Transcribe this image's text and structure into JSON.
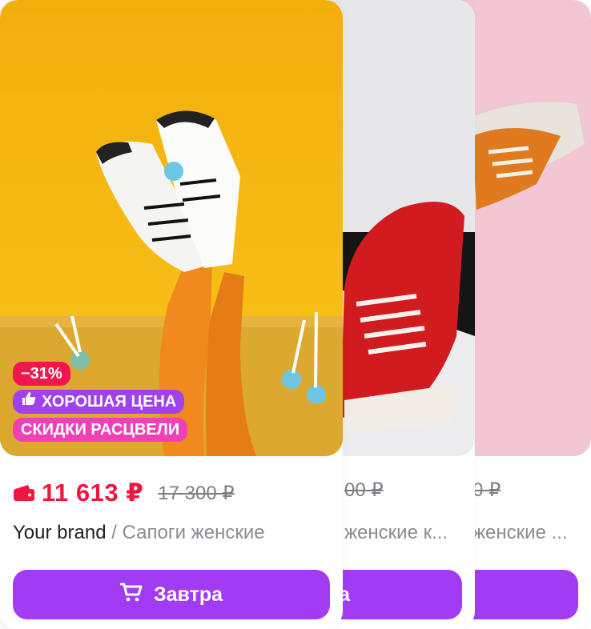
{
  "cards": [
    {
      "discount": "−31%",
      "good_price": "ХОРОШАЯ ЦЕНА",
      "promo": "СКИДКИ РАСЦВЕЛИ",
      "price": "11 613 ₽",
      "old_price": "17 300 ₽",
      "brand": "Your brand",
      "name": " / Сапоги женские",
      "button": "Завтра"
    },
    {
      "old_price": "00 ₽",
      "name": "женские к...",
      "button": "а"
    },
    {
      "old_price": "0 ₽",
      "name": "женские ...",
      "button": ""
    }
  ],
  "colors": {
    "accent": "#a23cf4",
    "price": "#f1163f"
  },
  "icons": {
    "wallet": "wallet-icon",
    "thumb": "thumbs-up-icon",
    "cart": "cart-icon"
  }
}
